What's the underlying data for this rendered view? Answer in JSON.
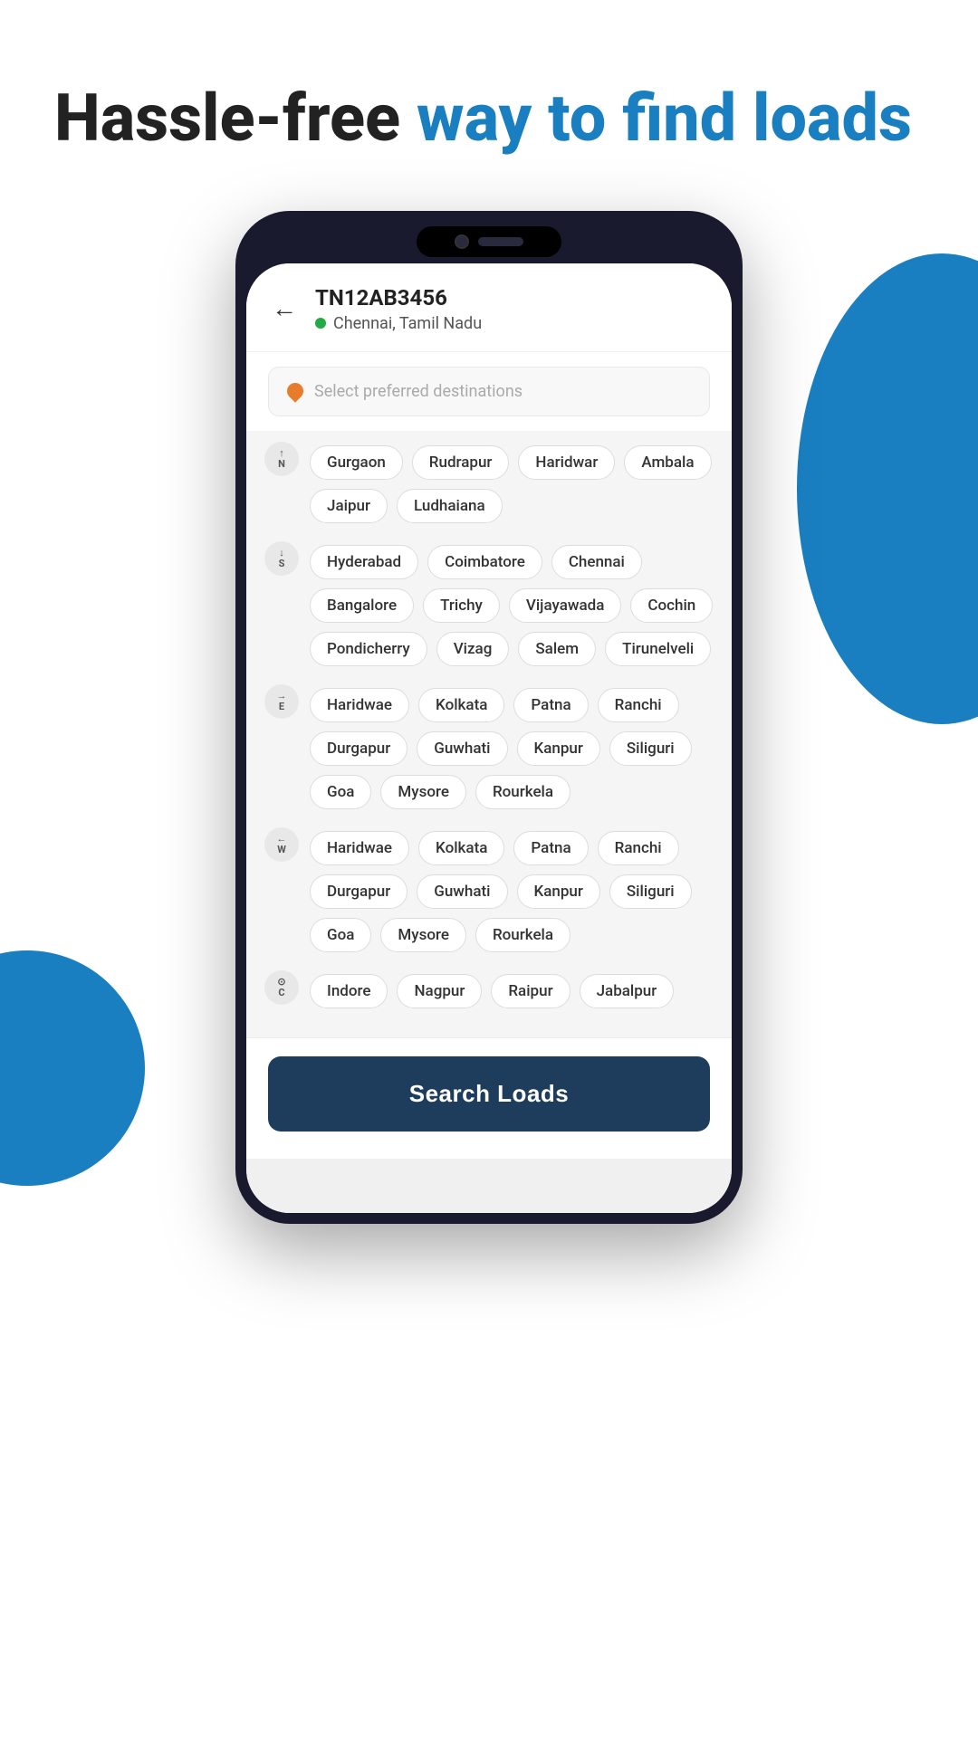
{
  "hero": {
    "title_normal": "Hassle-free ",
    "title_accent": "way to find loads"
  },
  "phone": {
    "vehicle_id": "TN12AB3456",
    "vehicle_location": "Chennai, Tamil Nadu",
    "search_placeholder": "Select preferred destinations",
    "search_button_label": "Search Loads"
  },
  "directions": [
    {
      "label": "N",
      "sublabel": "▲\nN",
      "icon_text": "↑\nN",
      "cities": [
        "Gurgaon",
        "Rudrapur",
        "Haridwar",
        "Ambala",
        "Jaipur",
        "Ludhaiana"
      ]
    },
    {
      "label": "S",
      "sublabel": "▼\nS",
      "icon_text": "↓\nS",
      "cities": [
        "Hyderabad",
        "Coimbatore",
        "Chennai",
        "Bangalore",
        "Trichy",
        "Vijayawada",
        "Cochin",
        "Pondicherry",
        "Vizag",
        "Salem",
        "Tirunelveli"
      ]
    },
    {
      "label": "E",
      "sublabel": "▶\nE",
      "icon_text": "→\nE",
      "cities": [
        "Haridwae",
        "Kolkata",
        "Patna",
        "Ranchi",
        "Durgapur",
        "Guwhati",
        "Kanpur",
        "Siliguri",
        "Goa",
        "Mysore",
        "Rourkela"
      ]
    },
    {
      "label": "W",
      "sublabel": "◀\nW",
      "icon_text": "←\nW",
      "cities": [
        "Haridwae",
        "Kolkata",
        "Patna",
        "Ranchi",
        "Durgapur",
        "Guwhati",
        "Kanpur",
        "Siliguri",
        "Goa",
        "Mysore",
        "Rourkela"
      ]
    },
    {
      "label": "C",
      "sublabel": "◉\nC",
      "icon_text": "⊙\nC",
      "cities": [
        "Indore",
        "Nagpur",
        "Raipur",
        "Jabalpur"
      ]
    }
  ],
  "colors": {
    "accent_blue": "#1a7fc1",
    "dark_navy": "#1e3d5c",
    "green_dot": "#22aa44",
    "orange_pin": "#e87c2c"
  }
}
